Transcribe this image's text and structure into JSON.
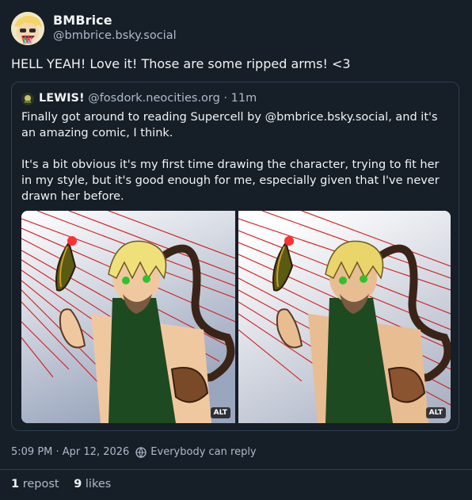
{
  "post": {
    "author": {
      "display_name": "BMBrice",
      "handle": "@bmbrice.bsky.social",
      "avatar": "avatar-icon"
    },
    "text": "HELL YEAH! Love it! Those are some ripped arms! <3",
    "timestamp": "5:09 PM · Apr 12, 2026",
    "reply_setting": "Everybody can reply",
    "reply_icon": "globe-icon",
    "stats": {
      "repost_count": "1",
      "repost_label": "repost",
      "like_count": "9",
      "like_label": "likes"
    }
  },
  "quote": {
    "author": {
      "display_name": "LEWIS!",
      "handle": "@fosdork.neocities.org",
      "age": "11m",
      "separator": " · "
    },
    "paragraph_1": "Finally got around to reading Supercell by @bmbrice.bsky.social, and it's an amazing comic, I think.",
    "paragraph_2": "It's a bit obvious it's my first time drawing the character, trying to fit her in my style, but it's good enough for me, especially given that I've never drawn her before.",
    "images": [
      {
        "alt_badge": "ALT",
        "description_icon": "fan-art-image"
      },
      {
        "alt_badge": "ALT",
        "description_icon": "fan-art-image"
      }
    ]
  },
  "colors": {
    "background": "#161e27",
    "text": "#f1f3f5",
    "muted": "#aebbc9",
    "border": "#2e4052"
  }
}
